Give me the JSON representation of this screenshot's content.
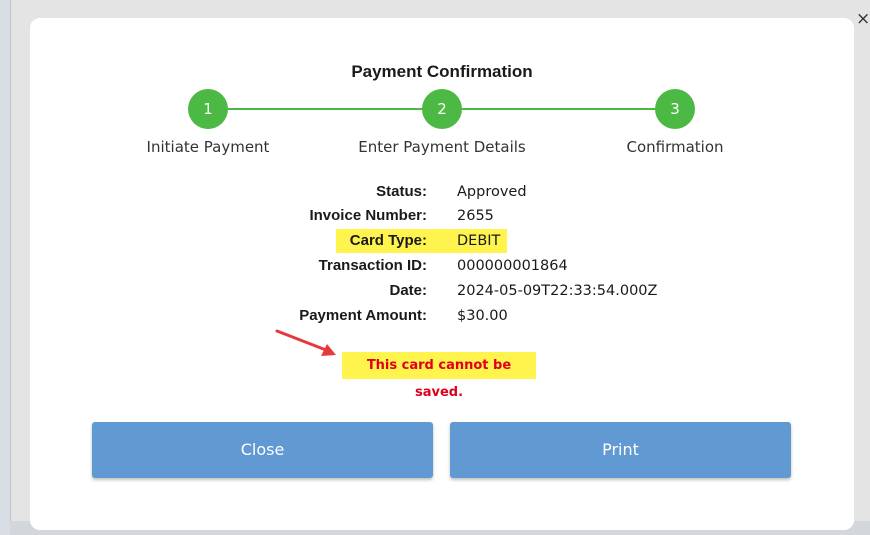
{
  "window": {
    "close_glyph": "×"
  },
  "modal": {
    "title": "Payment Confirmation",
    "steps": [
      {
        "number": "1",
        "label": "Initiate Payment"
      },
      {
        "number": "2",
        "label": "Enter Payment Details"
      },
      {
        "number": "3",
        "label": "Confirmation"
      }
    ],
    "details": [
      {
        "label": "Status:",
        "value": "Approved"
      },
      {
        "label": "Invoice Number:",
        "value": "2655"
      },
      {
        "label": "Card Type:",
        "value": "DEBIT"
      },
      {
        "label": "Transaction ID:",
        "value": "000000001864"
      },
      {
        "label": "Date:",
        "value": "2024-05-09T22:33:54.000Z"
      },
      {
        "label": "Payment Amount:",
        "value": "$30.00"
      }
    ],
    "warning_text": "This card cannot be saved.",
    "buttons": {
      "close_label": "Close",
      "print_label": "Print"
    }
  },
  "colors": {
    "step_green": "#4cb944",
    "button_blue": "#6199d2",
    "highlight_yellow": "#fff44d",
    "warning_red": "#e0001a",
    "annotation_arrow_red": "#e8383d"
  },
  "icons": {
    "window_close": "close-icon",
    "annotation": "red-arrow-icon"
  }
}
